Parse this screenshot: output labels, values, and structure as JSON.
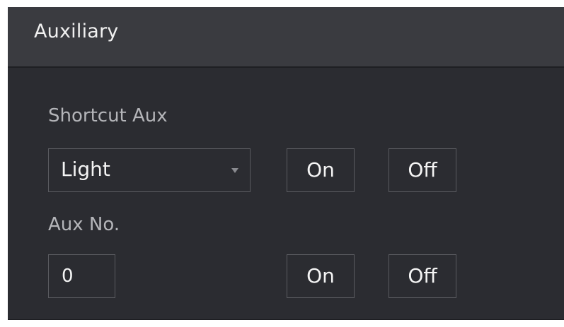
{
  "panel": {
    "title": "Auxiliary"
  },
  "shortcut_aux": {
    "label": "Shortcut Aux",
    "selected": "Light",
    "on_label": "On",
    "off_label": "Off"
  },
  "aux_no": {
    "label": "Aux No.",
    "value": "0",
    "on_label": "On",
    "off_label": "Off"
  },
  "icons": {
    "dropdown": "caret-down-icon"
  },
  "colors": {
    "panel_bg": "#2b2c31",
    "header_bg": "#3a3b40",
    "border": "#5a5b60",
    "label_text": "#b4b5b9",
    "value_text": "#f4f4f4"
  }
}
